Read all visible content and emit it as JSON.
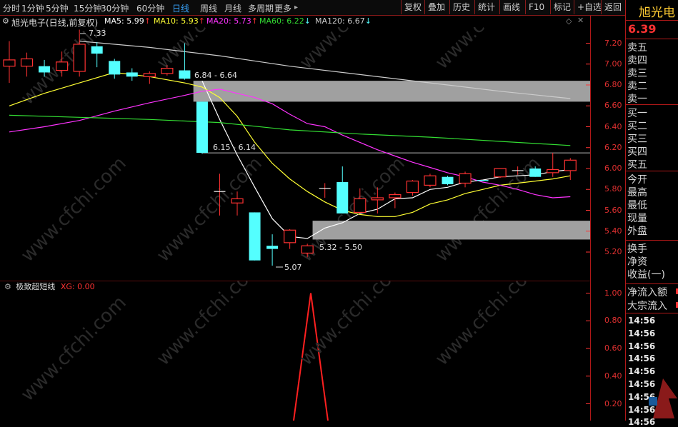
{
  "toolbar": {
    "periods": [
      "分时",
      "1分钟",
      "5分钟",
      "15分钟",
      "30分钟",
      "60分钟",
      "日线",
      "周线",
      "月线",
      "多周期",
      "更多"
    ],
    "active_period": "日线",
    "more_arrow": "▸",
    "buttons": [
      "复权",
      "叠加",
      "历史",
      "统计",
      "画线",
      "F10",
      "标记",
      "+自选",
      "返回"
    ]
  },
  "stock": {
    "name": "旭光电子",
    "chart_title": "旭光电子(日线,前复权)",
    "price": "6.39",
    "panel_name": "旭光电"
  },
  "ma_legend": [
    {
      "label": "MA5: 5.99",
      "color": "#ffffff",
      "arrow": "↑"
    },
    {
      "label": "MA10: 5.93",
      "color": "#ffff33",
      "arrow": "↑"
    },
    {
      "label": "MA20: 5.73",
      "color": "#ff33ff",
      "arrow": "↑"
    },
    {
      "label": "MA60: 6.22",
      "color": "#33dd33",
      "arrow": "↓"
    },
    {
      "label": "MA120: 6.67",
      "color": "#cccccc",
      "arrow": "↓"
    }
  ],
  "indicator": {
    "name": "极致超短线",
    "value_label": "XG: 0.00"
  },
  "watermark": "www.cfchi.com",
  "order_book": {
    "sell": [
      "卖五",
      "卖四",
      "卖三",
      "卖二",
      "卖一"
    ],
    "buy": [
      "买一",
      "买二",
      "买三",
      "买四",
      "买五"
    ]
  },
  "stats": [
    "今开",
    "最高",
    "最低",
    "现量",
    "外盘"
  ],
  "stats2": [
    "换手",
    "净资",
    "收益(一)"
  ],
  "flows": [
    "净流入额",
    "大宗流入"
  ],
  "times": [
    "14:56",
    "14:56",
    "14:56",
    "14:56",
    "14:56",
    "14:56",
    "14:56",
    "14:56",
    "14:56"
  ],
  "annotations": {
    "high_label": "7.33",
    "low_label": "5.07",
    "zone1": "6.84 - 6.64",
    "zone2": "6.15 - 6.14",
    "zone3": "5.32 - 5.50"
  },
  "colors": {
    "up": "#ff3232",
    "down": "#54ffff",
    "axis": "#ff3232",
    "bg": "#000000"
  },
  "chart_data": {
    "type": "candlestick",
    "y_ticks": [
      7.2,
      7.0,
      6.8,
      6.6,
      6.4,
      6.2,
      6.0,
      5.8,
      5.6,
      5.4,
      5.2
    ],
    "ylim": [
      5.08,
      7.32
    ],
    "candles": [
      {
        "o": 6.98,
        "c": 7.04,
        "h": 7.22,
        "l": 6.82
      },
      {
        "o": 6.98,
        "c": 7.05,
        "h": 7.11,
        "l": 6.88
      },
      {
        "o": 6.98,
        "c": 6.92,
        "h": 7.04,
        "l": 6.88
      },
      {
        "o": 6.94,
        "c": 7.02,
        "h": 7.12,
        "l": 6.88
      },
      {
        "o": 6.93,
        "c": 7.19,
        "h": 7.33,
        "l": 6.88
      },
      {
        "o": 7.17,
        "c": 7.1,
        "h": 7.21,
        "l": 6.97
      },
      {
        "o": 7.03,
        "c": 6.9,
        "h": 7.05,
        "l": 6.86
      },
      {
        "o": 6.92,
        "c": 6.88,
        "h": 6.96,
        "l": 6.84
      },
      {
        "o": 6.88,
        "c": 6.91,
        "h": 6.93,
        "l": 6.81
      },
      {
        "o": 6.91,
        "c": 6.96,
        "h": 6.99,
        "l": 6.89
      },
      {
        "o": 6.94,
        "c": 6.86,
        "h": 7.2,
        "l": 6.85
      },
      {
        "o": 6.64,
        "c": 6.15,
        "h": 6.64,
        "l": 6.14
      },
      {
        "o": 5.78,
        "c": 5.78,
        "h": 5.95,
        "l": 5.55
      },
      {
        "o": 5.67,
        "c": 5.71,
        "h": 5.78,
        "l": 5.55
      },
      {
        "o": 5.58,
        "c": 5.12,
        "h": 5.58,
        "l": 5.12
      },
      {
        "o": 5.26,
        "c": 5.23,
        "h": 5.37,
        "l": 5.07
      },
      {
        "o": 5.29,
        "c": 5.41,
        "h": 5.42,
        "l": 5.23
      },
      {
        "o": 5.19,
        "c": 5.26,
        "h": 5.28,
        "l": 5.15
      },
      {
        "o": 5.81,
        "c": 5.81,
        "h": 5.86,
        "l": 5.72
      },
      {
        "o": 5.87,
        "c": 5.57,
        "h": 6.02,
        "l": 5.57
      },
      {
        "o": 5.58,
        "c": 5.71,
        "h": 5.81,
        "l": 5.57
      },
      {
        "o": 5.7,
        "c": 5.72,
        "h": 5.82,
        "l": 5.57
      },
      {
        "o": 5.72,
        "c": 5.75,
        "h": 5.77,
        "l": 5.62
      },
      {
        "o": 5.77,
        "c": 5.88,
        "h": 5.89,
        "l": 5.74
      },
      {
        "o": 5.84,
        "c": 5.93,
        "h": 5.95,
        "l": 5.82
      },
      {
        "o": 5.92,
        "c": 5.85,
        "h": 5.93,
        "l": 5.84
      },
      {
        "o": 5.86,
        "c": 5.95,
        "h": 5.97,
        "l": 5.82
      },
      {
        "o": 5.89,
        "c": 5.88,
        "h": 5.89,
        "l": 5.88
      },
      {
        "o": 5.92,
        "c": 6.0,
        "h": 6.0,
        "l": 5.91
      },
      {
        "o": 5.98,
        "c": 5.98,
        "h": 6.02,
        "l": 5.94
      },
      {
        "o": 6.0,
        "c": 5.92,
        "h": 6.02,
        "l": 5.92
      },
      {
        "o": 5.96,
        "c": 5.99,
        "h": 6.15,
        "l": 5.92
      },
      {
        "o": 5.98,
        "c": 6.08,
        "h": 6.1,
        "l": 5.89
      }
    ],
    "ma_lines": [
      {
        "name": "MA5",
        "color": "#ffffff",
        "points": [
          [
            11,
            6.84
          ],
          [
            12,
            6.47
          ],
          [
            13,
            6.13
          ],
          [
            14,
            5.82
          ],
          [
            15,
            5.52
          ],
          [
            16,
            5.35
          ],
          [
            17,
            5.33
          ],
          [
            18,
            5.43
          ],
          [
            19,
            5.48
          ],
          [
            20,
            5.57
          ],
          [
            21,
            5.61
          ],
          [
            22,
            5.71
          ],
          [
            23,
            5.72
          ],
          [
            24,
            5.8
          ],
          [
            25,
            5.82
          ],
          [
            26,
            5.87
          ],
          [
            27,
            5.89
          ],
          [
            28,
            5.92
          ],
          [
            29,
            5.93
          ],
          [
            30,
            5.94
          ],
          [
            31,
            5.97
          ],
          [
            32,
            5.99
          ]
        ]
      },
      {
        "name": "MA10",
        "color": "#ffff33",
        "points": [
          [
            0,
            6.6
          ],
          [
            2,
            6.72
          ],
          [
            4,
            6.82
          ],
          [
            6,
            6.92
          ],
          [
            8,
            6.88
          ],
          [
            10,
            6.82
          ],
          [
            11,
            6.78
          ],
          [
            12,
            6.68
          ],
          [
            13,
            6.5
          ],
          [
            14,
            6.25
          ],
          [
            15,
            6.05
          ],
          [
            16,
            5.9
          ],
          [
            17,
            5.78
          ],
          [
            18,
            5.68
          ],
          [
            19,
            5.6
          ],
          [
            20,
            5.56
          ],
          [
            21,
            5.54
          ],
          [
            22,
            5.54
          ],
          [
            23,
            5.58
          ],
          [
            24,
            5.66
          ],
          [
            25,
            5.7
          ],
          [
            26,
            5.76
          ],
          [
            27,
            5.8
          ],
          [
            28,
            5.84
          ],
          [
            29,
            5.86
          ],
          [
            30,
            5.88
          ],
          [
            31,
            5.9
          ],
          [
            32,
            5.93
          ]
        ]
      },
      {
        "name": "MA20",
        "color": "#ff33ff",
        "points": [
          [
            0,
            6.35
          ],
          [
            2,
            6.4
          ],
          [
            4,
            6.46
          ],
          [
            6,
            6.55
          ],
          [
            8,
            6.63
          ],
          [
            10,
            6.7
          ],
          [
            11,
            6.74
          ],
          [
            12,
            6.76
          ],
          [
            13,
            6.72
          ],
          [
            14,
            6.68
          ],
          [
            15,
            6.62
          ],
          [
            16,
            6.52
          ],
          [
            17,
            6.43
          ],
          [
            18,
            6.4
          ],
          [
            19,
            6.32
          ],
          [
            20,
            6.25
          ],
          [
            21,
            6.18
          ],
          [
            22,
            6.12
          ],
          [
            23,
            6.06
          ],
          [
            24,
            6.01
          ],
          [
            25,
            5.96
          ],
          [
            26,
            5.92
          ],
          [
            27,
            5.87
          ],
          [
            28,
            5.84
          ],
          [
            29,
            5.8
          ],
          [
            30,
            5.75
          ],
          [
            31,
            5.72
          ],
          [
            32,
            5.73
          ]
        ]
      },
      {
        "name": "MA60",
        "color": "#33dd33",
        "points": [
          [
            0,
            6.51
          ],
          [
            4,
            6.49
          ],
          [
            8,
            6.47
          ],
          [
            12,
            6.44
          ],
          [
            16,
            6.37
          ],
          [
            20,
            6.33
          ],
          [
            24,
            6.3
          ],
          [
            28,
            6.26
          ],
          [
            32,
            6.22
          ]
        ]
      },
      {
        "name": "MA120",
        "color": "#cccccc",
        "points": [
          [
            4,
            7.22
          ],
          [
            8,
            7.16
          ],
          [
            12,
            7.08
          ],
          [
            16,
            6.98
          ],
          [
            20,
            6.9
          ],
          [
            24,
            6.82
          ],
          [
            28,
            6.74
          ],
          [
            32,
            6.67
          ]
        ]
      }
    ],
    "zones": [
      {
        "from_idx": 10.5,
        "to_idx": 33.2,
        "low": 6.64,
        "high": 6.84,
        "label": "6.84 - 6.64"
      },
      {
        "from_idx": 17.3,
        "to_idx": 33.2,
        "low": 5.32,
        "high": 5.5,
        "label": "5.32 - 5.50"
      }
    ],
    "lines": [
      {
        "from_idx": 11,
        "to_idx": 33.2,
        "value": 6.15,
        "label": "6.15 - 6.14"
      }
    ],
    "indicator": {
      "name": "极致超短线",
      "y_ticks": [
        1.0,
        0.8,
        0.6,
        0.4,
        0.2
      ],
      "ylim": [
        0,
        1.08
      ],
      "series": [
        {
          "name": "XG",
          "values": [
            0,
            0,
            0,
            0,
            0,
            0,
            0,
            0,
            0,
            0,
            0,
            0,
            0,
            0,
            0,
            0,
            0,
            1,
            0,
            0,
            0,
            0,
            0,
            0,
            0,
            0,
            0,
            0,
            0,
            0,
            0,
            0,
            0
          ]
        }
      ]
    }
  }
}
